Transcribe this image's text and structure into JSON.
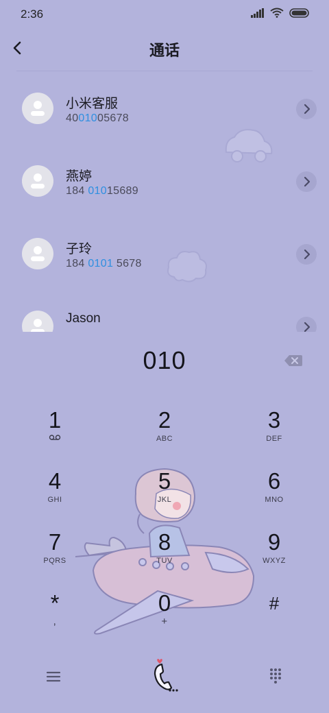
{
  "status": {
    "time": "2:36"
  },
  "header": {
    "title": "通话"
  },
  "contacts": [
    {
      "name": "小米客服",
      "num_pre": "40",
      "num_hl": "010",
      "num_post": "05678"
    },
    {
      "name": "燕婷",
      "num_pre": "184 ",
      "num_hl": "010",
      "num_post": "15689"
    },
    {
      "name": "子玲",
      "num_pre": "184 ",
      "num_hl": "0101",
      "num_post": " 5678"
    },
    {
      "name": "Jason",
      "num_pre": "",
      "num_hl": "",
      "num_post": ""
    }
  ],
  "dial": {
    "value": "010"
  },
  "keys": [
    {
      "digit": "1",
      "letters": ""
    },
    {
      "digit": "2",
      "letters": "ABC"
    },
    {
      "digit": "3",
      "letters": "DEF"
    },
    {
      "digit": "4",
      "letters": "GHI"
    },
    {
      "digit": "5",
      "letters": "JKL"
    },
    {
      "digit": "6",
      "letters": "MNO"
    },
    {
      "digit": "7",
      "letters": "PQRS"
    },
    {
      "digit": "8",
      "letters": "TUV"
    },
    {
      "digit": "9",
      "letters": "WXYZ"
    },
    {
      "digit": "*",
      "letters": ","
    },
    {
      "digit": "0",
      "letters": "+"
    },
    {
      "digit": "#",
      "letters": ""
    }
  ],
  "icons": {
    "back": "back-arrow-icon",
    "chevron": "chevron-right-icon",
    "backspace": "backspace-icon",
    "voicemail": "voicemail-icon",
    "menu": "menu-icon",
    "call": "call-icon",
    "keypad": "keypad-icon"
  },
  "colors": {
    "background": "#b3b3dc",
    "highlight": "#2f8fe0"
  }
}
